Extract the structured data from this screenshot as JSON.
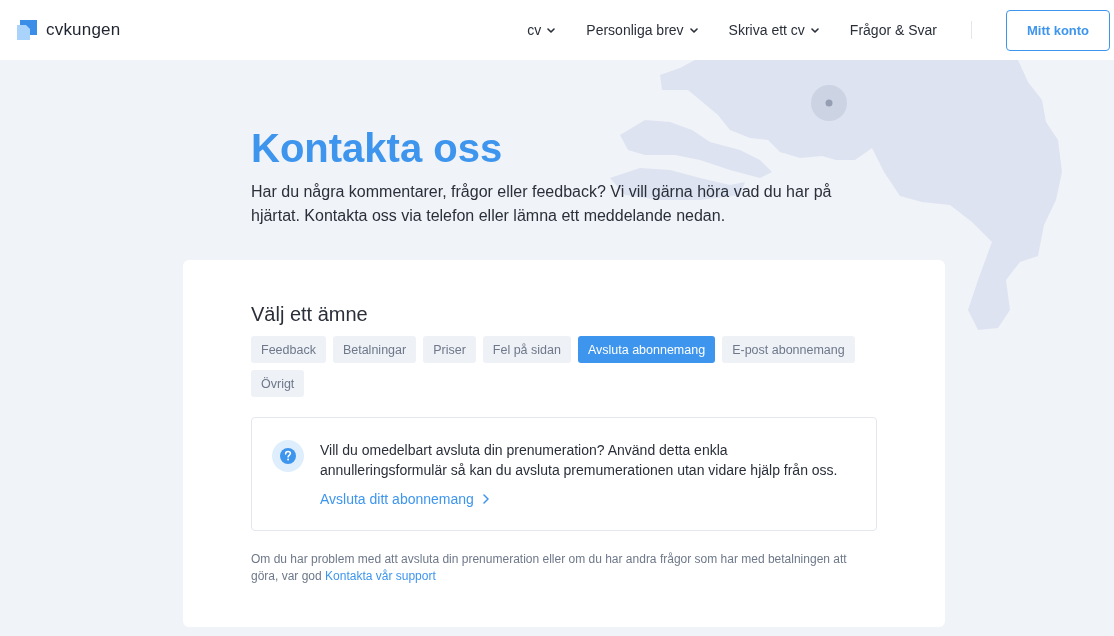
{
  "header": {
    "logo_text": "cvkungen",
    "nav": [
      {
        "label": "cv",
        "dropdown": true
      },
      {
        "label": "Personliga brev",
        "dropdown": true
      },
      {
        "label": "Skriva ett cv",
        "dropdown": true
      },
      {
        "label": "Frågor & Svar",
        "dropdown": false
      }
    ],
    "account_button": "Mitt konto"
  },
  "hero": {
    "title": "Kontakta oss",
    "intro": "Har du några kommentarer, frågor eller feedback? Vi vill gärna höra vad du har på hjärtat. Kontakta oss via telefon eller lämna ett meddelande nedan."
  },
  "topic_picker": {
    "heading": "Välj ett ämne",
    "topics": [
      {
        "label": "Feedback",
        "selected": false
      },
      {
        "label": "Betalningar",
        "selected": false
      },
      {
        "label": "Priser",
        "selected": false
      },
      {
        "label": "Fel på sidan",
        "selected": false
      },
      {
        "label": "Avsluta abonnemang",
        "selected": true
      },
      {
        "label": "E-post abonnemang",
        "selected": false
      },
      {
        "label": "Övrigt",
        "selected": false
      }
    ]
  },
  "info_box": {
    "text": "Vill du omedelbart avsluta din prenumeration? Använd detta enkla annulleringsformulär så kan du avsluta premumerationen utan vidare hjälp från oss.",
    "link": "Avsluta ditt abonnemang"
  },
  "footnote": {
    "text": "Om du har problem med att avsluta din prenumeration eller om du har andra frågor som har med betalningen att göra, var god",
    "link": "Kontakta vår support"
  }
}
